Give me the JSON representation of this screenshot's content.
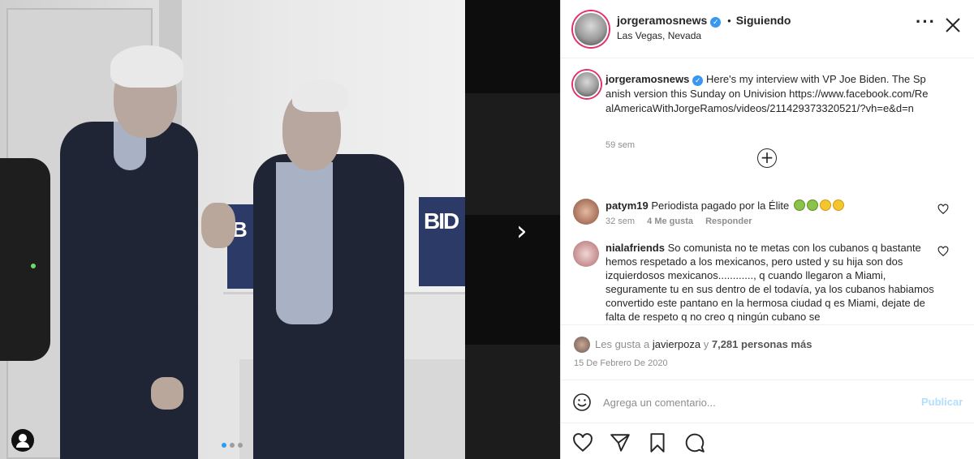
{
  "post": {
    "username": "jorgeramosnews",
    "follow_status": "Siguiendo",
    "follow_separator": "•",
    "location": "Las Vegas, Nevada",
    "caption": "Here's my interview with VP Joe Biden. The Spanish version this Sunday on Univision https://www.facebook.com/RealAmericaWithJorgeRamos/videos/211429373320521/?vh=e&d=n",
    "caption_time": "59 sem",
    "photo_sign_text": "BID",
    "photo_sign_text2": "B",
    "carousel_index": 1,
    "carousel_count": 3
  },
  "comments": [
    {
      "username": "patym19",
      "text": "Periodista pagado por la Élite",
      "time": "32 sem",
      "likes": "4 Me gusta",
      "reply": "Responder",
      "avatar_color": "#a6705a"
    },
    {
      "username": "nialafriends",
      "text": "So comunista no te metas con los cubanos q bastante hemos respetado a los mexicanos, pero usted y su hija son dos izquierdosos mexicanos............, q cuando llegaron a Miami, seguramente tu en sus dentro de el todavía, ya los cubanos habiamos convertido este pantano en la hermosa ciudad q es Miami, dejate de falta de respeto q no creo q ningún cubano se",
      "avatar_color": "#c48b8b"
    }
  ],
  "likes": {
    "prefix": "Les gusta a",
    "user": "javierpoza",
    "connector": "y",
    "others": "7,281 personas más"
  },
  "post_date": "15 De Febrero De 2020",
  "comment_box": {
    "placeholder": "Agrega un comentario...",
    "publish_label": "Publicar"
  },
  "colors": {
    "accent": "#3897f0",
    "publish_disabled": "#b2dffc",
    "story_ring": "#e1306c",
    "muted_text": "#8e8e8e"
  }
}
